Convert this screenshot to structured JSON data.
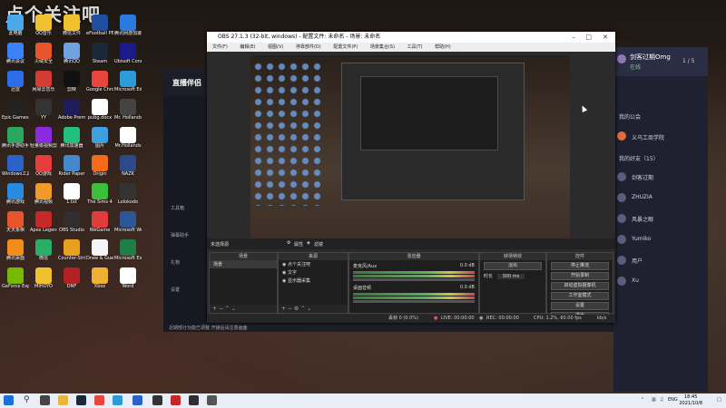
{
  "watermark": "点个关注吧",
  "desktop_icons": [
    {
      "label": "此电脑",
      "color": "#4aa8e8"
    },
    {
      "label": "QQ音乐",
      "color": "#f2c12e"
    },
    {
      "label": "微信文件",
      "color": "#f2c12e"
    },
    {
      "label": "eFootball PES 2021",
      "color": "#1e4fa0"
    },
    {
      "label": "腾讯网游加速器",
      "color": "#2b7ae0"
    },
    {
      "label": "腾讯会议",
      "color": "#3b82f6"
    },
    {
      "label": "火绒安全",
      "color": "#e8552a"
    },
    {
      "label": "腾讯QQ",
      "color": "#6fa3e0"
    },
    {
      "label": "Steam",
      "color": "#1b2838"
    },
    {
      "label": "Ubisoft Connect",
      "color": "#1a1a8a"
    },
    {
      "label": "迅雷",
      "color": "#2b6ee8"
    },
    {
      "label": "网易云音乐",
      "color": "#d43c33"
    },
    {
      "label": "剪映",
      "color": "#111111"
    },
    {
      "label": "Google Chrome",
      "color": "#e8453c"
    },
    {
      "label": "Microsoft Edge",
      "color": "#2d9bd8"
    },
    {
      "label": "Epic Games Launcher",
      "color": "#222222"
    },
    {
      "label": "YY",
      "color": "#333333"
    },
    {
      "label": "Adobe Premiere",
      "color": "#1e1c5a"
    },
    {
      "label": "pubg.docx",
      "color": "#ffffff"
    },
    {
      "label": "Mr. Hollands",
      "color": "#444444"
    },
    {
      "label": "腾讯手游助手",
      "color": "#2aa860"
    },
    {
      "label": "轻量级视频剪辑",
      "color": "#8a2be2"
    },
    {
      "label": "腾讯加速器",
      "color": "#22c07a"
    },
    {
      "label": "图片",
      "color": "#3fa0e0"
    },
    {
      "label": "Mr.Hollands",
      "color": "#ffffff"
    },
    {
      "label": "Windows工具",
      "color": "#2a62c8"
    },
    {
      "label": "QQ游戏",
      "color": "#e63c3c"
    },
    {
      "label": "Rider Paper",
      "color": "#4488cc"
    },
    {
      "label": "Origin",
      "color": "#f56a1a"
    },
    {
      "label": "NAZK",
      "color": "#2c4a88"
    },
    {
      "label": "腾讯游戏",
      "color": "#2a8ae0"
    },
    {
      "label": "腾讯视频",
      "color": "#f09a2a"
    },
    {
      "label": "1.txt",
      "color": "#ffffff"
    },
    {
      "label": "The Sims 4",
      "color": "#3cbf3c"
    },
    {
      "label": "Lolokodo",
      "color": "#333333"
    },
    {
      "label": "天天象棋",
      "color": "#e8552a"
    },
    {
      "label": "Apex Legends",
      "color": "#c62828"
    },
    {
      "label": "OBS Studio",
      "color": "#302e31"
    },
    {
      "label": "WeGame",
      "color": "#e03c3c"
    },
    {
      "label": "Microsoft Word",
      "color": "#2b5797"
    },
    {
      "label": "腾讯桌面",
      "color": "#f28c1a"
    },
    {
      "label": "微信",
      "color": "#2aae67"
    },
    {
      "label": "Counter-Strike GO",
      "color": "#e8a020"
    },
    {
      "label": "Draw & Guess",
      "color": "#f5f5f5"
    },
    {
      "label": "Microsoft Excel 2010",
      "color": "#1e7e45"
    },
    {
      "label": "GeForce Experience",
      "color": "#76b900"
    },
    {
      "label": "MIHOYO",
      "color": "#f0c030"
    },
    {
      "label": "DNF",
      "color": "#b22222"
    },
    {
      "label": "Xbox",
      "color": "#f0b030"
    },
    {
      "label": "Word",
      "color": "#ffffff"
    }
  ],
  "obs": {
    "title": "OBS 27.1.3 (32-bit, windows) - 配置文件: 未命名 - 场景: 未命名",
    "menu": [
      "文件(F)",
      "编辑(E)",
      "视图(V)",
      "停靠部件(D)",
      "配置文件(P)",
      "场景集合(S)",
      "工具(T)",
      "帮助(H)"
    ],
    "no_source": "未选择源",
    "props_btn": "属性",
    "filters_btn": "滤镜",
    "panels": {
      "scenes": "场景",
      "sources": "来源",
      "mixer": "混音器",
      "transitions": "转场特效",
      "controls": "控件"
    },
    "scene_items": [
      "场景"
    ],
    "source_items": [
      "点个关注吧",
      "文字",
      "显示器采集"
    ],
    "mixer": [
      {
        "name": "桌面音频",
        "level": "0.0 dB"
      },
      {
        "name": "麦克风/Aux",
        "level": "0.0 dB"
      }
    ],
    "transition": {
      "type": "淡出",
      "duration_label": "时长",
      "duration": "300 ms"
    },
    "controls": [
      "停止推流",
      "开始录制",
      "启动虚拟摄像机",
      "工作室模式",
      "设置",
      "退出"
    ],
    "status": {
      "dropped": "丢帧 0 (0.0%)",
      "live": "LIVE: 00:00:00",
      "rec": "REC: 00:00:00",
      "cpu": "CPU: 1.2%, 60.00 fps",
      "kbps": "kb/s"
    }
  },
  "live_app": {
    "logo": "直播伴侣",
    "side_items": [
      "工具箱",
      "弹幕助手",
      "礼物",
      "设置"
    ],
    "notice": "近期部分功能已调整 开播后请注意画面"
  },
  "chat": {
    "user": "剑客过期Omg",
    "online": "在线",
    "count": "1 / 5",
    "sections": [
      "我的公会",
      "义乌工商学院",
      "我的好友（15）"
    ],
    "friends": [
      "剑客过期",
      "ZHUZIA",
      "风暴之眼",
      "Yumiko",
      "用户",
      "Xu"
    ]
  },
  "taskbar": {
    "lang": "ENG",
    "time": "18:45",
    "date": "2021/10/8"
  }
}
